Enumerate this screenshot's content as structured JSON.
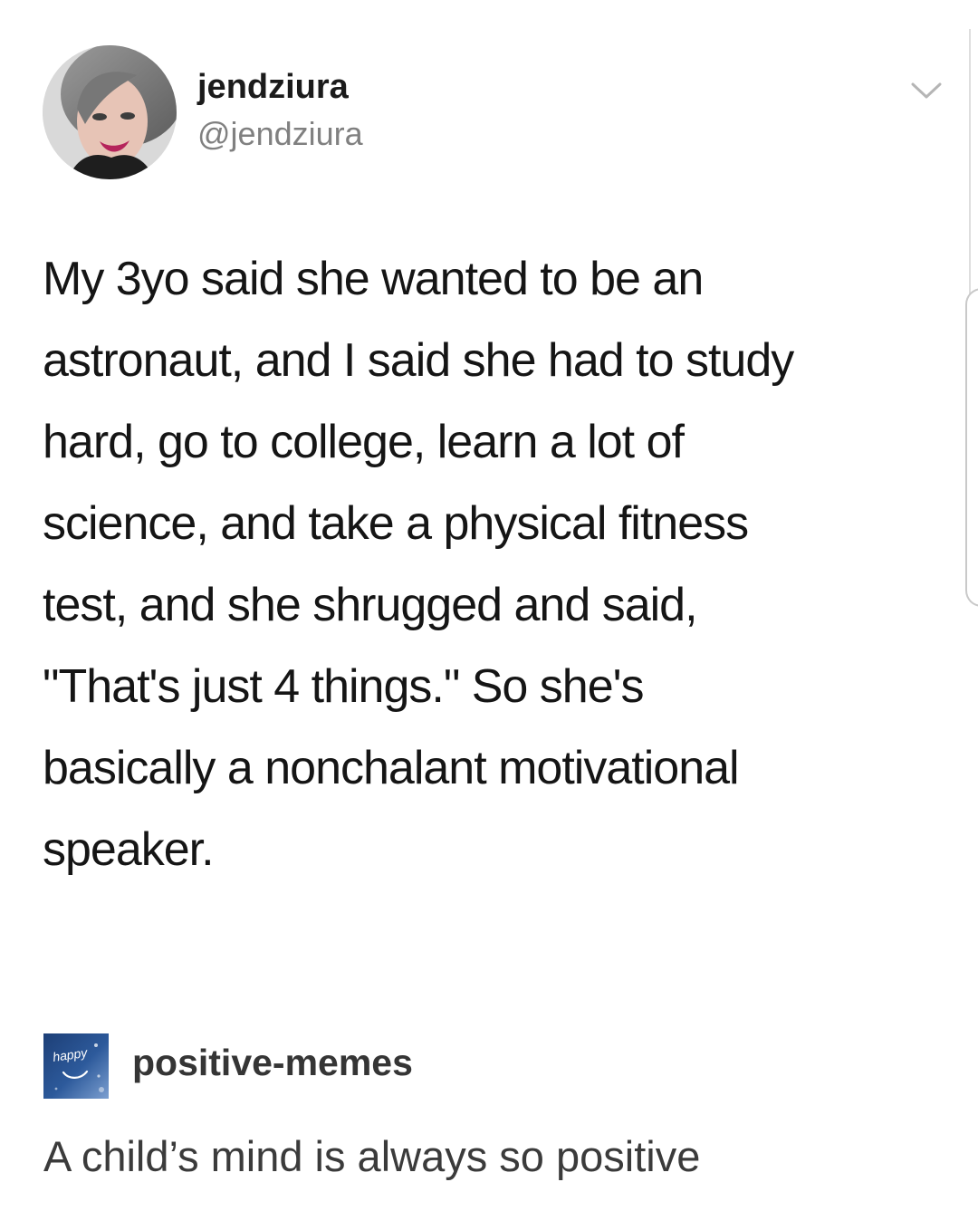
{
  "tweet": {
    "display_name": "jendziura",
    "handle": "@jendziura",
    "text": "My 3yo said she wanted to be an\nastronaut, and I said she had to study\nhard, go to college, learn a lot of\nscience, and take a physical fitness\ntest, and she shrugged and said,\n\"That's just 4 things.\" So she's\nbasically a nonchalant motivational\nspeaker.",
    "avatar_icon": "profile-photo",
    "menu_icon": "chevron-down-icon"
  },
  "post": {
    "blog_icon": "happy-blog-icon",
    "blog_icon_text": "happy",
    "blog_name": "positive-memes",
    "caption": "A child’s mind is always so positive"
  },
  "colors": {
    "text": "#151515",
    "handle": "#808080",
    "blog_icon": "#2d5a9b",
    "caption": "#3b3b3b"
  }
}
